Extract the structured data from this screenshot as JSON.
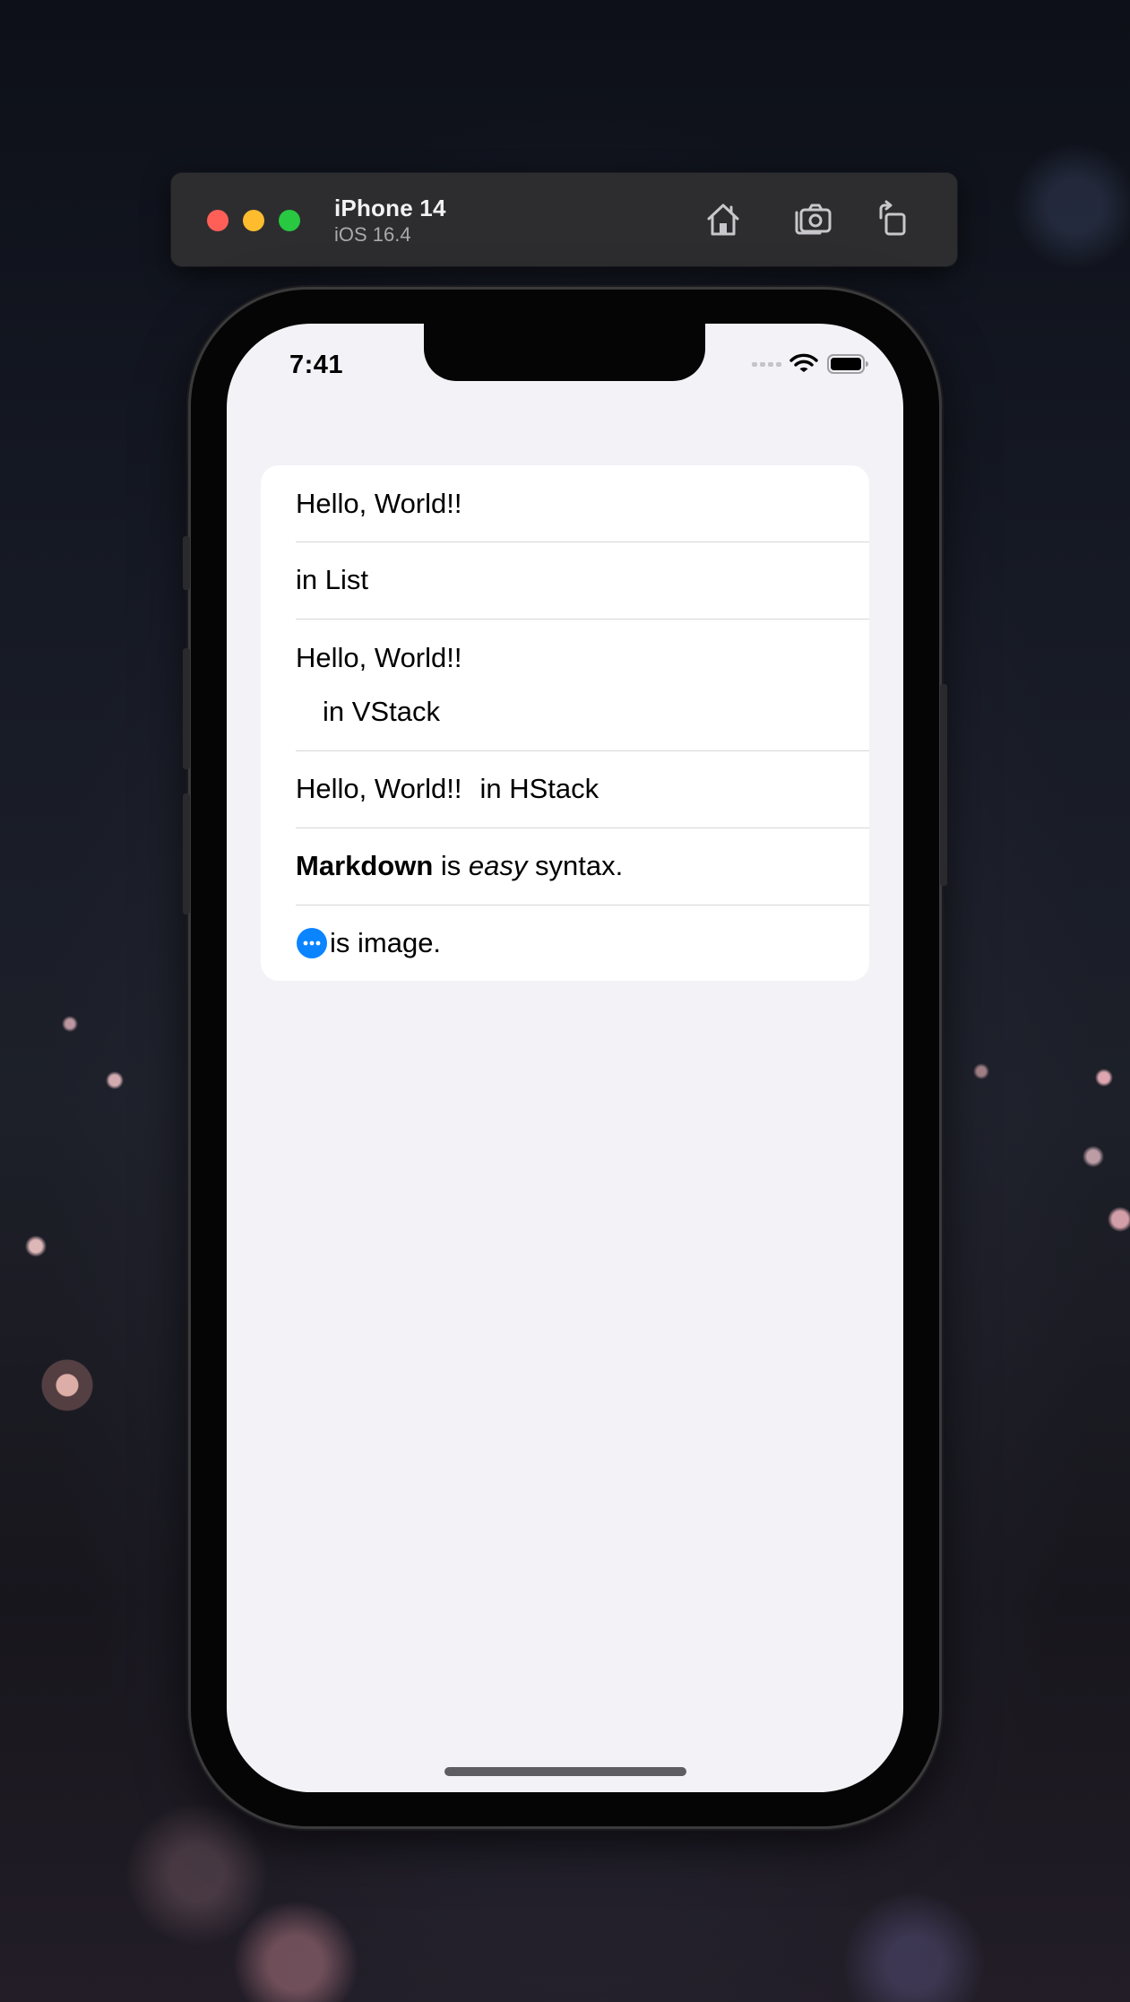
{
  "simulator": {
    "device_name": "iPhone 14",
    "os_version": "iOS 16.4",
    "buttons": [
      {
        "icon": "home-icon"
      },
      {
        "icon": "screenshot-icon"
      },
      {
        "icon": "rotate-icon"
      }
    ]
  },
  "status_bar": {
    "time": "7:41"
  },
  "list": {
    "row1": "Hello, World!!",
    "row2": "in List",
    "row3": {
      "line1": "Hello, World!!",
      "line2": "in VStack"
    },
    "row4": {
      "part1": "Hello, World!!",
      "part2": "in HStack"
    },
    "row5": {
      "bold": "Markdown",
      "text1": " is ",
      "italic": "easy",
      "text2": " syntax."
    },
    "row6": {
      "icon": "ellipsis-circle-icon",
      "text": "is image."
    }
  },
  "colors": {
    "screen_background": "#f2f2f7",
    "accent": "#0a84ff",
    "traffic_red": "#ff5f57",
    "traffic_yellow": "#febc2e",
    "traffic_green": "#28c840"
  }
}
